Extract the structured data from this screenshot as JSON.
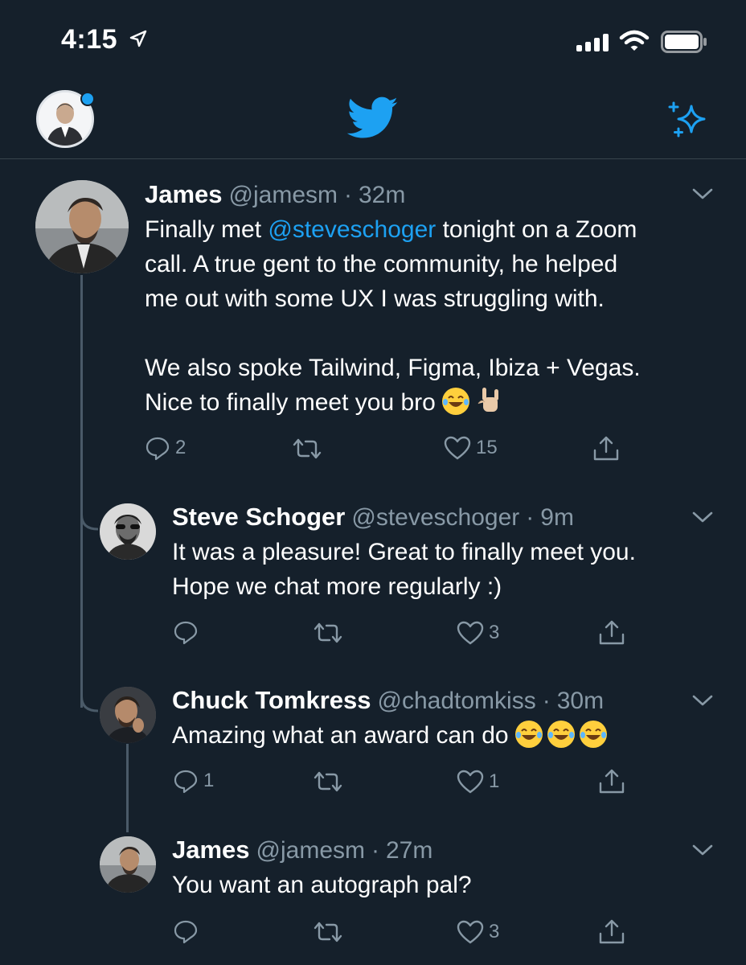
{
  "status_bar": {
    "time": "4:15"
  },
  "tweets": [
    {
      "name": "James",
      "handle": "@jamesm",
      "sep": "·",
      "time": "32m",
      "text_before": "Finally met ",
      "mention": "@steveschoger",
      "text_after": " tonight on a Zoom\ncall. A true gent to the community, he helped\nme out with some UX I was struggling with.\n\nWe also spoke Tailwind, Figma, Ibiza + Vegas.\nNice to finally meet you bro",
      "replies": "2",
      "retweets": "",
      "likes": "15"
    },
    {
      "name": "Steve Schoger",
      "handle": "@steveschoger",
      "sep": "·",
      "time": "9m",
      "text": "It was a pleasure! Great to finally meet you.\nHope we chat more regularly :)",
      "replies": "",
      "retweets": "",
      "likes": "3"
    },
    {
      "name": "Chuck Tomkress",
      "handle": "@chadtomkiss",
      "sep": "·",
      "time": "30m",
      "text": "Amazing what an award can do",
      "replies": "1",
      "retweets": "",
      "likes": "1"
    },
    {
      "name": "James",
      "handle": "@jamesm",
      "sep": "·",
      "time": "27m",
      "text": "You want an autograph pal?",
      "replies": "",
      "retweets": "",
      "likes": "3"
    }
  ],
  "colors": {
    "background": "#15202b",
    "accent": "#1da1f2",
    "muted": "#8899a6"
  },
  "icons": [
    "location-arrow-icon",
    "signal-icon",
    "wifi-icon",
    "battery-icon",
    "twitter-bird-icon",
    "sparkle-icon",
    "chevron-down-icon",
    "reply-icon",
    "retweet-icon",
    "like-icon",
    "share-icon"
  ]
}
